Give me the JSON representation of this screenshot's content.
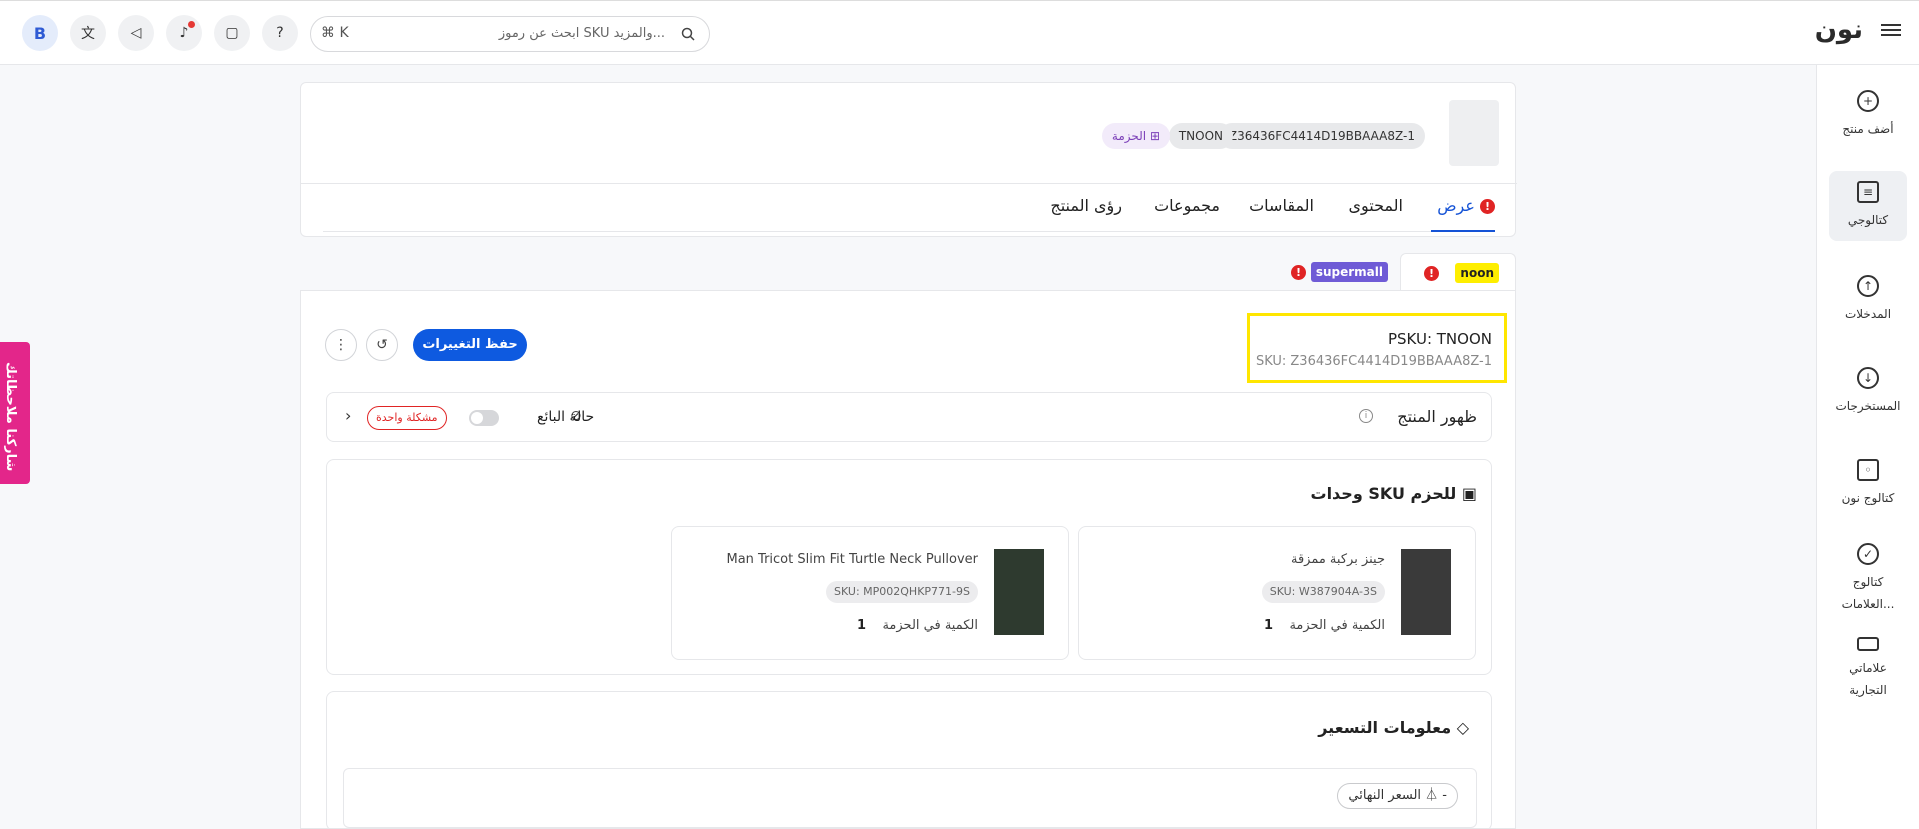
{
  "topbar": {
    "logo": "نون",
    "search_placeholder": "ابحث عن رموز SKU والمزيد...",
    "search_shortcut": "⌘ K",
    "avatar_initial": "B"
  },
  "sidebar": {
    "items": [
      {
        "label": "أضف منتج",
        "icon": "plus-circle-icon"
      },
      {
        "label": "كتالوجي",
        "icon": "book-icon"
      },
      {
        "label": "المدخلات",
        "icon": "cloud-upload-icon"
      },
      {
        "label": "المستخرجات",
        "icon": "cloud-download-icon"
      },
      {
        "label": "كتالوج نون",
        "icon": "catalog-icon"
      },
      {
        "label": "كتالوج العلامات...",
        "icon": "badge-check-icon"
      },
      {
        "label": "علاماتي التجارية",
        "icon": "tag-icon"
      }
    ]
  },
  "feedback_label": "شاركنا ملاحظاتك",
  "product_header": {
    "sku_pill": "Z36436FC4414D19BBAAA8Z-1",
    "brand_pill": "TNOON",
    "bundle_pill": "الحزمة"
  },
  "tabs": [
    "عرض",
    "المحتوى",
    "المقاسات",
    "مجموعات",
    "رؤى المنتج"
  ],
  "store_tabs": {
    "noon": "noon",
    "supermall": "supermall"
  },
  "psku": {
    "title": "PSKU: TNOON",
    "sub": "SKU: Z36436FC4414D19BBAAA8Z-1"
  },
  "save_button": "حفظ التغييرات",
  "visibility": {
    "label": "ظهور المنتج",
    "seller_status": "حالة البائع",
    "issue": "مشكلة واحدة"
  },
  "bundle": {
    "title": "وحدات SKU للحزم",
    "items": [
      {
        "name": "جينز بركبة ممزقة",
        "sku": "SKU: W387904A-3S",
        "qty_label": "الكمية في الحزمة",
        "qty": "1"
      },
      {
        "name": "Man Tricot Slim Fit Turtle Neck Pullover",
        "sku": "SKU: MP002QHKP771-9S",
        "qty_label": "الكمية في الحزمة",
        "qty": "1"
      }
    ]
  },
  "pricing": {
    "title": "معلومات التسعير",
    "final_price": "السعر النهائي ⏃ -"
  }
}
